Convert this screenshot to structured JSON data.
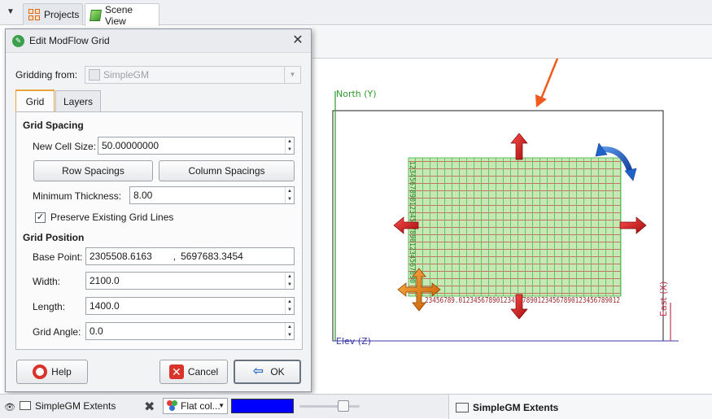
{
  "tabs": {
    "projects": "Projects",
    "scene": "Scene View"
  },
  "dialog": {
    "title": "Edit ModFlow Grid",
    "gridding_from_label": "Gridding from:",
    "gridding_from_value": "SimpleGM",
    "tab_grid": "Grid",
    "tab_layers": "Layers",
    "grid_spacing_heading": "Grid Spacing",
    "new_cell_size_label": "New Cell Size:",
    "new_cell_size_value": "50.00000000",
    "row_spacings": "Row Spacings",
    "column_spacings": "Column Spacings",
    "min_thickness_label": "Minimum Thickness:",
    "min_thickness_value": "8.00",
    "preserve_label": "Preserve Existing Grid Lines",
    "preserve_checked": "✓",
    "grid_position_heading": "Grid Position",
    "base_point_label": "Base Point:",
    "base_point_x": "2305508.6163",
    "base_point_sep": ",",
    "base_point_y": "5697683.3454",
    "width_label": "Width:",
    "width_value": "2100.0",
    "length_label": "Length:",
    "length_value": "1400.0",
    "grid_angle_label": "Grid Angle:",
    "grid_angle_value": "0.0",
    "help": "Help",
    "cancel": "Cancel",
    "ok": "OK"
  },
  "scene": {
    "north_label": "North (Y)",
    "east_label": "East (X)",
    "elev_label": "Elev (Z)",
    "bottom_tick_text": "23456789.0123456789012345678901234567890123456789012",
    "left_tick_text": "123456789012345678901234567890",
    "colors": {
      "grid_fill": "#c6e8b4",
      "grid_h_lines": "#cc3b3b",
      "grid_v_lines": "#5cbf5c",
      "move_arrows": "#cc1515",
      "rotate_arrow": "#1f63c9",
      "base_handle": "#e8821e",
      "callout_arrow": "#f05a1e",
      "north_axis": "#2e9a2e",
      "east_axis": "#c0394b",
      "elev_axis": "#3a3aa6"
    }
  },
  "bottom": {
    "object_label": "SimpleGM Extents",
    "color_mode": "Flat col...",
    "swatch_color": "#0000ff",
    "right_title": "SimpleGM Extents"
  }
}
